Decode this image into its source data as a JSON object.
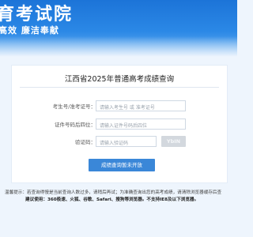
{
  "header": {
    "title": "育考试院",
    "slogan": "高效  廉洁奉献"
  },
  "card": {
    "title": "江西省2025年普通高考成绩查询",
    "exam_id_label": "考生号/准考证号：",
    "exam_id_placeholder": "请输入考生号 或 准考证号",
    "id_last4_label": "证件号码后四位：",
    "id_last4_placeholder": "请输入证件号码后四位",
    "captcha_label": "验证码：",
    "captcha_placeholder": "请输入验证码",
    "captcha_image_text": "YbIN",
    "submit_label": "成绩查询暂未开放"
  },
  "tips": {
    "line1": "温馨提示：若查询得慢是当前查询人数过多，请稍后再试；为准确查询出您的高考成绩，请清除浏览器缓存后查",
    "line2": "建议使用：360极速、火狐、谷歌、Safari、搜狗等浏览器。不支持IE8及以下浏览器。"
  },
  "colors": {
    "banner": "#1c74d8",
    "button": "#3a87d8",
    "background": "#eef5fd"
  }
}
